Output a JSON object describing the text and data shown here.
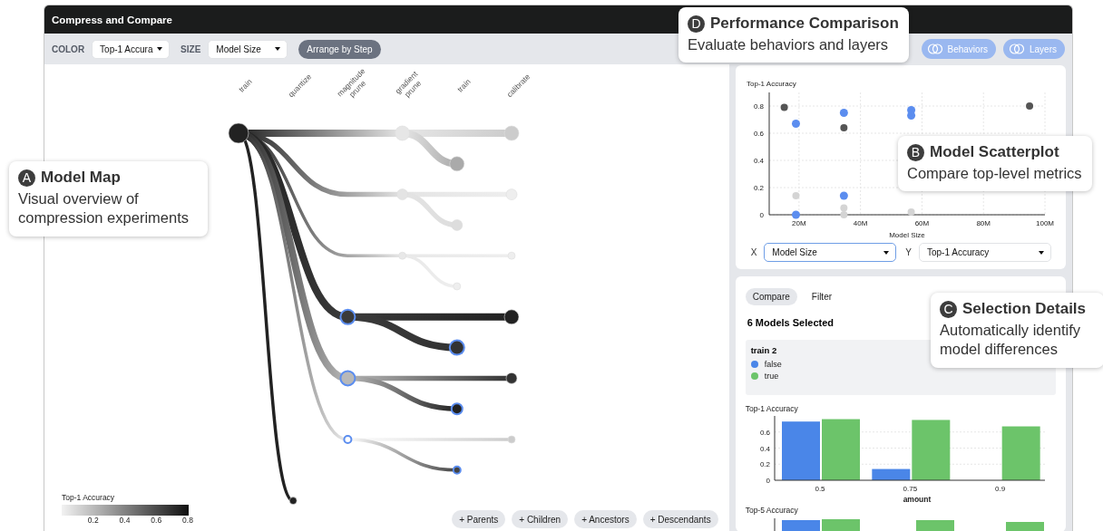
{
  "window": {
    "title": "Compress and Compare"
  },
  "toolbar": {
    "color_label": "COLOR",
    "color_value": "Top-1 Accura",
    "size_label": "SIZE",
    "size_value": "Model Size",
    "arrange_button": "Arrange by Step",
    "view_buttons": [
      "Behaviors",
      "Layers"
    ]
  },
  "map": {
    "steps": [
      "train",
      "quantize",
      "magnitude prune",
      "gradient prune",
      "train",
      "calibrate"
    ],
    "nodes": [
      {
        "selected": false
      },
      {
        "selected": false
      },
      {
        "selected": false
      },
      {
        "selected": false
      },
      {
        "selected": false
      },
      {
        "selected": false
      },
      {
        "selected": false
      },
      {
        "selected": false
      },
      {
        "selected": false
      },
      {
        "selected": false
      },
      {
        "selected": true
      },
      {
        "selected": false
      },
      {
        "selected": true
      },
      {
        "selected": true
      },
      {
        "selected": false
      },
      {
        "selected": true
      },
      {
        "selected": true
      },
      {
        "selected": false
      },
      {
        "selected": true
      },
      {
        "selected": false
      }
    ],
    "legend": {
      "title": "Top-1 Accuracy",
      "ticks": [
        "0.2",
        "0.4",
        "0.6",
        "0.8"
      ]
    },
    "buttons": [
      "+ Parents",
      "+ Children",
      "+ Ancestors",
      "+ Descendants"
    ]
  },
  "scatterplot": {
    "chart_data": {
      "type": "scatter",
      "xlabel": "Model Size",
      "ylabel": "Top-1 Accuracy",
      "x": [
        15.2,
        19,
        19,
        19,
        34.6,
        34.6,
        34.6,
        34.6,
        34.6,
        56.5,
        56.5,
        56.5,
        95
      ],
      "series": [
        {
          "color": "#5b8def",
          "values": [
            null,
            0.67,
            0,
            null,
            0.75,
            null,
            0.14,
            null,
            null,
            0.77,
            0.73,
            null,
            null
          ]
        },
        {
          "color": "#555555",
          "values": [
            0.79,
            null,
            null,
            null,
            null,
            0.64,
            null,
            null,
            null,
            null,
            null,
            null,
            0.8
          ]
        },
        {
          "color": "#d4d4d4",
          "values": [
            null,
            null,
            null,
            0.14,
            null,
            null,
            null,
            0.05,
            0,
            null,
            null,
            0.02,
            null
          ]
        }
      ],
      "xlim": [
        10.3,
        100
      ],
      "ylim": [
        0,
        0.9
      ],
      "grid": true,
      "xticks": [
        {
          "value": 20,
          "label": "20M"
        },
        {
          "value": 40,
          "label": "40M"
        },
        {
          "value": 60,
          "label": "60M"
        },
        {
          "value": 80,
          "label": "80M"
        },
        {
          "value": 100,
          "label": "100M"
        }
      ],
      "yticks": [
        {
          "value": 0,
          "label": "0"
        },
        {
          "value": 0.2,
          "label": "0.2"
        },
        {
          "value": 0.4,
          "label": "0.4"
        },
        {
          "value": 0.6,
          "label": "0.6"
        },
        {
          "value": 0.8,
          "label": "0.8"
        }
      ]
    },
    "x_label": "X",
    "x_value": "Model Size",
    "y_label": "Y",
    "y_value": "Top-1 Accuracy"
  },
  "details": {
    "tabs": [
      {
        "label": "Compare",
        "selected": true
      },
      {
        "label": "Filter",
        "selected": false
      }
    ],
    "heading": "6 Models Selected",
    "legend": {
      "title": "train 2",
      "items": [
        {
          "label": "false",
          "color": "#4a86e8"
        },
        {
          "label": "true",
          "color": "#6cc46a"
        }
      ]
    },
    "chart_data": {
      "type": "bar",
      "title": "Top-1 Accuracy",
      "xlabel": "amount",
      "categories": [
        "0.5",
        "0.75",
        "0.9"
      ],
      "series": [
        {
          "color": "#4a86e8",
          "values": [
            0.73,
            0.14,
            null
          ]
        },
        {
          "color": "#6cc46a",
          "values": [
            0.76,
            0.75,
            0.67
          ]
        }
      ],
      "ylim": [
        0,
        0.8
      ],
      "grid": true,
      "yticks": [
        {
          "value": 0,
          "label": "0"
        },
        {
          "value": 0.2,
          "label": "0.2"
        },
        {
          "value": 0.4,
          "label": "0.4"
        },
        {
          "value": 0.6,
          "label": "0.6"
        }
      ]
    },
    "second_chart_title": "Top-5 Accuracy"
  },
  "callouts": [
    {
      "letter": "A",
      "title": "Model Map",
      "text": "Visual overview of compression experiments"
    },
    {
      "letter": "D",
      "title": "Performance Comparison",
      "text": "Evaluate behaviors and layers"
    },
    {
      "letter": "B",
      "title": "Model Scatterplot",
      "text": "Compare top-level metrics"
    },
    {
      "letter": "C",
      "title": "Selection Details",
      "text": "Automatically identify model differences"
    }
  ]
}
